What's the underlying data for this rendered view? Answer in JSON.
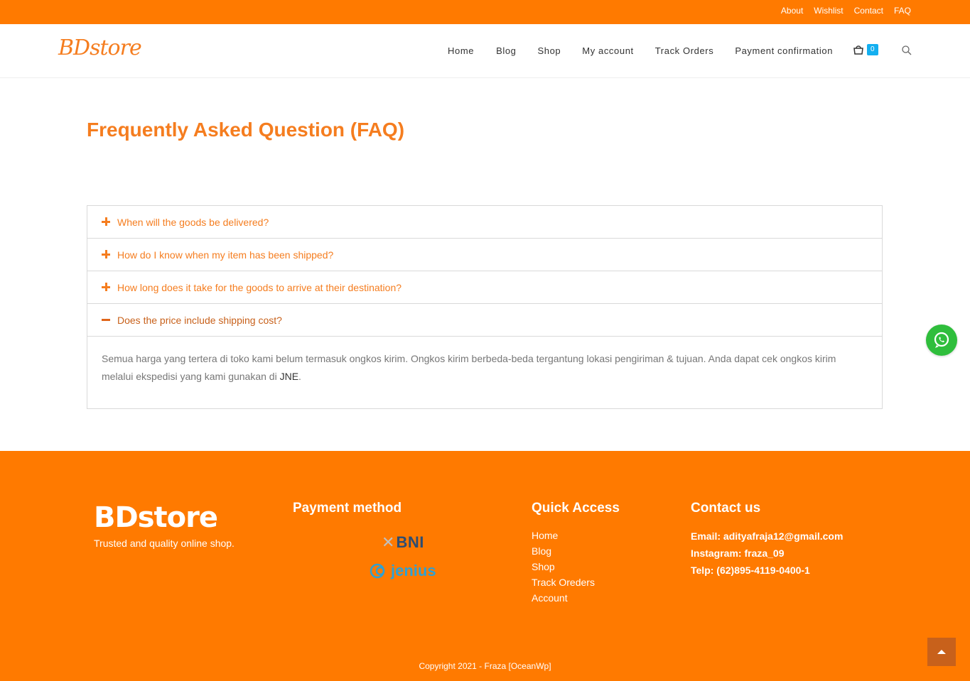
{
  "topbar": {
    "links": [
      "About",
      "Wishlist",
      "Contact",
      "FAQ"
    ]
  },
  "header": {
    "logo": "BDstore",
    "nav": [
      "Home",
      "Blog",
      "Shop",
      "My account",
      "Track Orders",
      "Payment confirmation"
    ],
    "cart_count": "0"
  },
  "page": {
    "title": "Frequently Asked Question (FAQ)"
  },
  "faq": {
    "items": [
      {
        "question": "When will the goods be delivered?",
        "expanded": false
      },
      {
        "question": "How do I know when my item has been shipped?",
        "expanded": false
      },
      {
        "question": "How long does it take for the goods to arrive at their destination?",
        "expanded": false
      },
      {
        "question": "Does the price include shipping cost?",
        "expanded": true
      }
    ],
    "answer": "Semua harga yang tertera di toko kami belum termasuk ongkos kirim. Ongkos kirim berbeda-beda tergantung lokasi pengiriman & tujuan. Anda dapat cek ongkos kirim melalui ekspedisi yang kami gunakan di ",
    "answer_link": "JNE",
    "answer_end": "."
  },
  "footer": {
    "logo": "BDstore",
    "tagline": "Trusted and quality online shop.",
    "payment_title": "Payment method",
    "payment_bni": "BNI",
    "payment_jenius": "jenius",
    "quick_title": "Quick Access",
    "quick_links": [
      "Home",
      "Blog",
      "Shop",
      "Track Oreders",
      "Account"
    ],
    "contact_title": "Contact us",
    "email": "Email: adityafraja12@gmail.com",
    "instagram": "Instagram: fraza_09",
    "phone": "Telp: (62)895-4119-0400-1",
    "copyright": "Copyright 2021 - Fraza [OceanWp]"
  },
  "colors": {
    "brand": "#ff7a00",
    "title": "#f57d1f",
    "badge": "#13aff0",
    "whatsapp": "#2fbe3c"
  }
}
